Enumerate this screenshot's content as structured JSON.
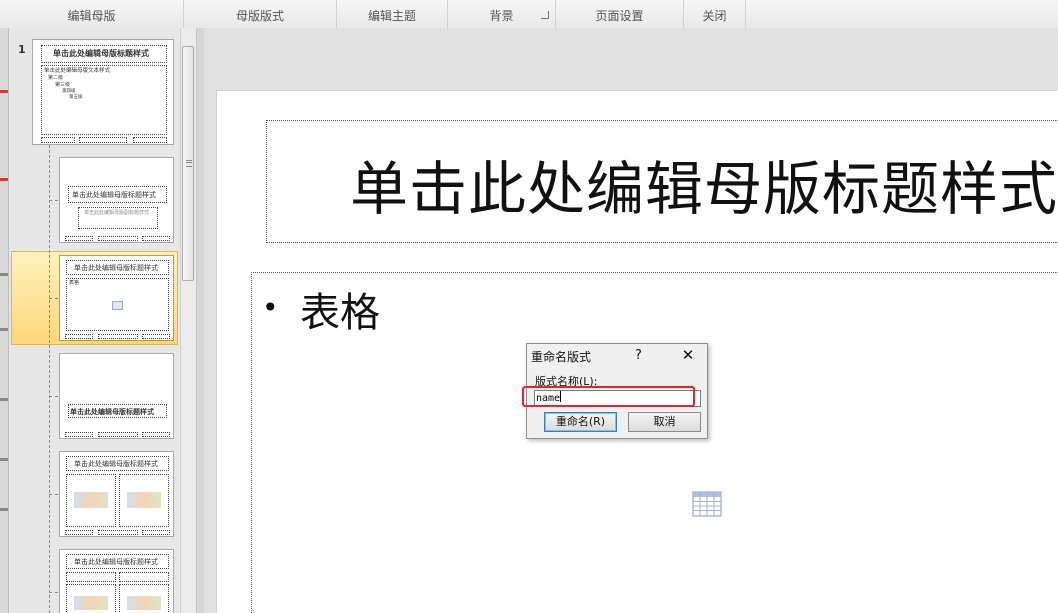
{
  "ribbon": {
    "groups": [
      "编辑母版",
      "母版版式",
      "编辑主题",
      "背景",
      "页面设置",
      "关闭"
    ]
  },
  "thumbnails": {
    "slide_number": "1",
    "master": {
      "title": "单击此处编辑母版标题样式",
      "body_lines": [
        "单击此处编辑母版文本样式",
        "第二级",
        "第三级",
        "第四级",
        "第五级"
      ]
    },
    "layout_title": "单击此处编辑母版标题样式",
    "layout_subtitle": "单击此处编辑母版副标题样式",
    "layout_body": "表格"
  },
  "slide": {
    "title": "单击此处编辑母版标题样式",
    "body_bullet": "•",
    "body_text": "表格"
  },
  "dialog": {
    "title": "重命名版式",
    "help": "?",
    "close": "✕",
    "field_label": "版式名称(L):",
    "field_value": "name",
    "rename_button": "重命名(R)",
    "cancel_button": "取消"
  },
  "colors": {
    "selection": "#ffd77a",
    "highlight": "#e8242a",
    "default_button_border": "#3c7fb1"
  }
}
